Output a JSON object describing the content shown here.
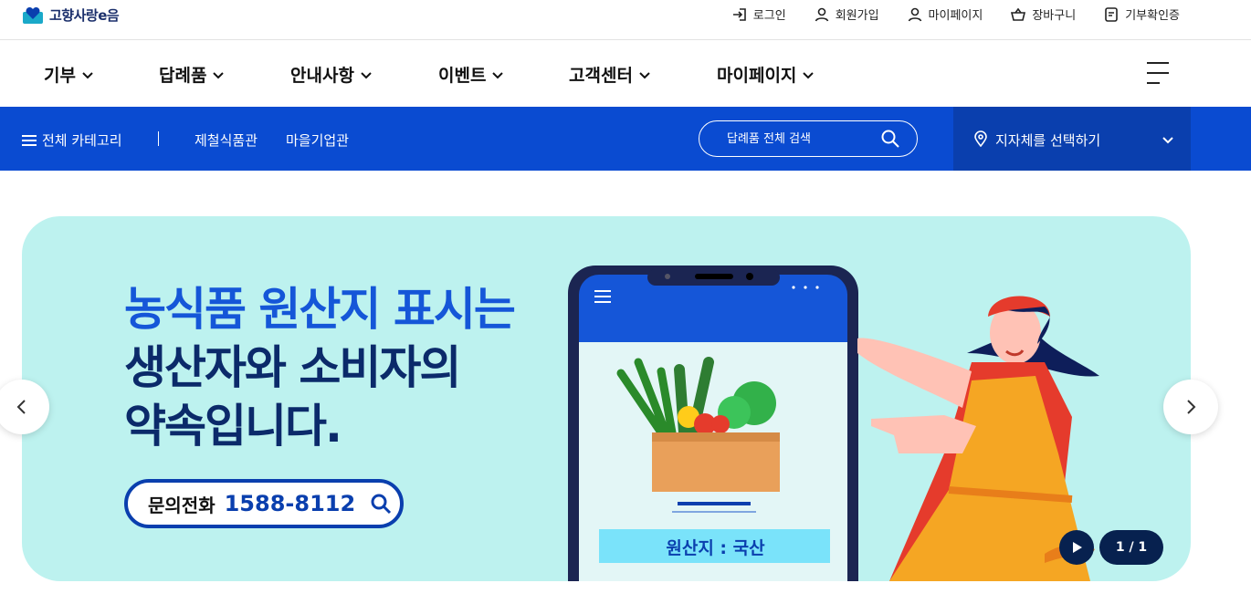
{
  "logo": {
    "text": "고향사랑e음"
  },
  "utility": [
    {
      "label": "로그인",
      "icon": "login-icon"
    },
    {
      "label": "회원가입",
      "icon": "user-icon"
    },
    {
      "label": "마이페이지",
      "icon": "user-icon"
    },
    {
      "label": "장바구니",
      "icon": "basket-icon"
    },
    {
      "label": "기부확인증",
      "icon": "document-icon"
    }
  ],
  "gnb": [
    "기부",
    "답례품",
    "안내사항",
    "이벤트",
    "고객센터",
    "마이페이지"
  ],
  "subnav": {
    "all_categories": "전체 카테고리",
    "links": [
      "제철식품관",
      "마을기업관"
    ],
    "search_placeholder": "답례품 전체 검색",
    "region_select": "지자체를 선택하기"
  },
  "banner": {
    "line1": "농식품 원산지 표시는",
    "line2": "생산자와 소비자의",
    "line3": "약속입니다.",
    "phone_label": "문의전화",
    "phone_number": "1588-8112",
    "origin_label": "원산지 : 국산",
    "page_indicator": "1 / 1"
  },
  "colors": {
    "primary": "#0a4bd1",
    "banner_bg": "#bdf2ef",
    "headline": "#0b2a6a",
    "accent": "#1556d8"
  }
}
